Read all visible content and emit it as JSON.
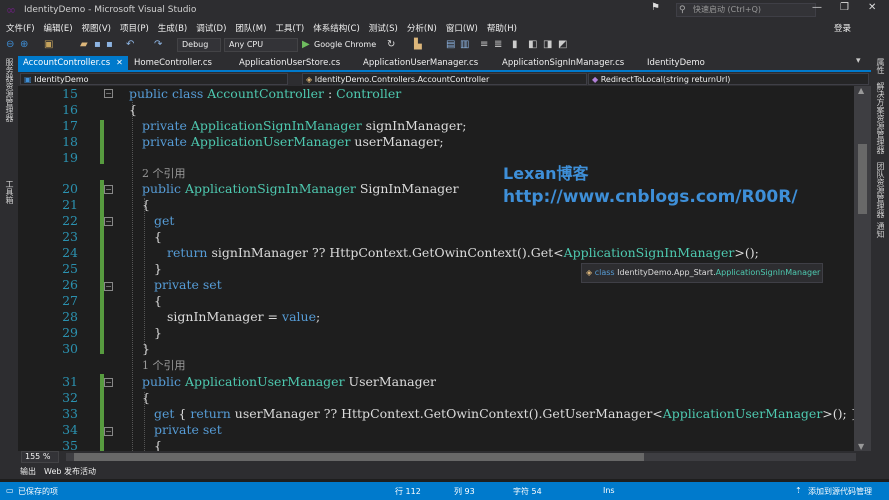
{
  "window": {
    "title": "IdentityDemo - Microsoft Visual Studio",
    "quick_launch": "快速启动 (Ctrl+Q)",
    "flag_icon": "flag-icon",
    "minimize": "—",
    "restore": "❐",
    "close": "✕"
  },
  "menu": [
    "文件(F)",
    "编辑(E)",
    "视图(V)",
    "项目(P)",
    "生成(B)",
    "调试(D)",
    "团队(M)",
    "工具(T)",
    "体系结构(C)",
    "测试(S)",
    "分析(N)",
    "窗口(W)",
    "帮助(H)"
  ],
  "login": "登录",
  "toolbar": {
    "config": "Debug",
    "platform": "Any CPU",
    "browser": "Google Chrome"
  },
  "left_panels": [
    "服务器资源管理器",
    "工具箱"
  ],
  "right_panels": [
    "属性",
    "解决方案资源管理器",
    "团队资源管理器",
    "通知"
  ],
  "tabs": [
    "AccountController.cs",
    "HomeController.cs",
    "ApplicationUserStore.cs",
    "ApplicationUserManager.cs",
    "ApplicationSignInManager.cs",
    "IdentityDemo"
  ],
  "nav": {
    "project": "IdentityDemo",
    "class": "IdentityDemo.Controllers.AccountController",
    "member": "RedirectToLocal(string returnUrl)"
  },
  "code": {
    "l15": {
      "n": "15",
      "kw": "public class ",
      "ty": "AccountController",
      "rest": " : ",
      "ty2": "Controller"
    },
    "l16": {
      "n": "16",
      "t": "{"
    },
    "l17": {
      "n": "17",
      "kw": "private ",
      "ty": "ApplicationSignInManager",
      "rest": " signInManager;"
    },
    "l18": {
      "n": "18",
      "kw": "private ",
      "ty": "ApplicationUserManager",
      "rest": " userManager;"
    },
    "l19": {
      "n": "19"
    },
    "ref1": "2 个引用",
    "l20": {
      "n": "20",
      "kw": "public ",
      "ty": "ApplicationSignInManager",
      "rest": " SignInManager"
    },
    "l21": {
      "n": "21",
      "t": "{"
    },
    "l22": {
      "n": "22",
      "kw": "get"
    },
    "l23": {
      "n": "23",
      "t": "{"
    },
    "l24": {
      "n": "24",
      "kw": "return ",
      "rest": "signInManager ?? HttpContext.GetOwinContext().Get<",
      "ty": "ApplicationSignInManager",
      "rest2": ">();"
    },
    "l25": {
      "n": "25",
      "t": "}"
    },
    "l26": {
      "n": "26",
      "kw": "private set"
    },
    "l27": {
      "n": "27",
      "t": "{"
    },
    "l28": {
      "n": "28",
      "rest": "signInManager = ",
      "kw": "value",
      "rest2": ";"
    },
    "l29": {
      "n": "29",
      "t": "}"
    },
    "l30": {
      "n": "30",
      "t": "}"
    },
    "ref2": "1 个引用",
    "l31": {
      "n": "31",
      "kw": "public ",
      "ty": "ApplicationUserManager",
      "rest": " UserManager"
    },
    "l32": {
      "n": "32",
      "t": "{"
    },
    "l33": {
      "n": "33",
      "kw": "get",
      "rest": " { ",
      "kw2": "return ",
      "rest2": "userManager ?? HttpContext.GetOwinContext().GetUserManager<",
      "ty": "ApplicationUserManager",
      "rest3": ">(); }"
    },
    "l34": {
      "n": "34",
      "kw": "private set"
    },
    "l35": {
      "n": "35",
      "t": "{"
    }
  },
  "watermark": {
    "name": "Lexan博客",
    "url": "http://www.cnblogs.com/R00R/"
  },
  "tooltip": {
    "kw": "class ",
    "ns": "IdentityDemo.App_Start.",
    "ty": "ApplicationSignInManager"
  },
  "zoom": "155 %",
  "output_tabs": [
    "输出",
    "Web 发布活动"
  ],
  "status": {
    "ready": "已保存的项",
    "line": "行 112",
    "col": "列 93",
    "char": "字符 54",
    "mode": "Ins",
    "source": "添加到源代码管理"
  }
}
